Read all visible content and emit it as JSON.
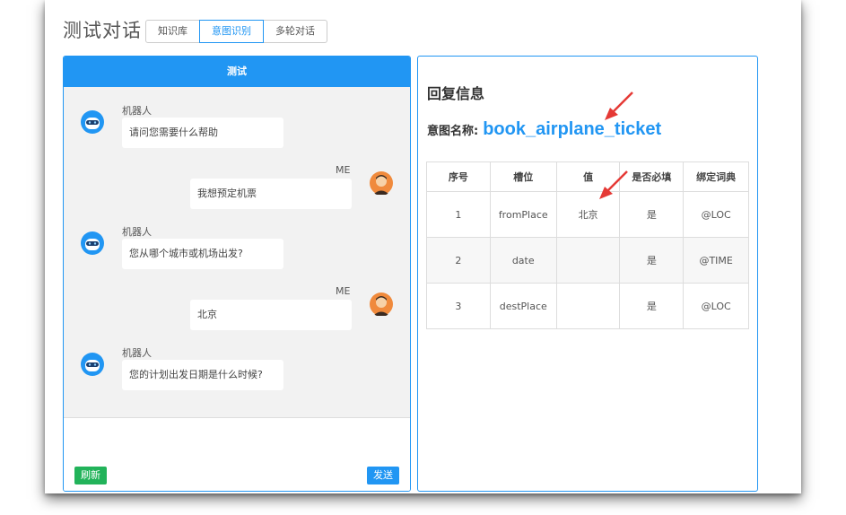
{
  "page": {
    "title": "测试对话"
  },
  "tabs": [
    {
      "label": "知识库",
      "active": false
    },
    {
      "label": "意图识别",
      "active": true
    },
    {
      "label": "多轮对话",
      "active": false
    }
  ],
  "chat": {
    "header": "测试",
    "messages": [
      {
        "sender": "机器人",
        "text": "请问您需要什么帮助"
      },
      {
        "sender": "ME",
        "text": "我想预定机票"
      },
      {
        "sender": "机器人",
        "text": "您从哪个城市或机场出发?"
      },
      {
        "sender": "ME",
        "text": "北京"
      },
      {
        "sender": "机器人",
        "text": "您的计划出发日期是什么时候?"
      }
    ],
    "refresh_label": "刷新",
    "send_label": "发送"
  },
  "reply": {
    "title": "回复信息",
    "intent_label": "意图名称:",
    "intent_value": "book_airplane_ticket",
    "columns": [
      "序号",
      "槽位",
      "值",
      "是否必填",
      "绑定词典"
    ],
    "rows": [
      [
        "1",
        "fromPlace",
        "北京",
        "是",
        "@LOC"
      ],
      [
        "2",
        "date",
        "",
        "是",
        "@TIME"
      ],
      [
        "3",
        "destPlace",
        "",
        "是",
        "@LOC"
      ]
    ]
  },
  "colors": {
    "accent": "#2196f3",
    "success": "#22b35a",
    "annotation_arrow": "#e53935"
  },
  "icons": {
    "bot": "robot-avatar-icon",
    "user": "user-avatar-icon"
  }
}
